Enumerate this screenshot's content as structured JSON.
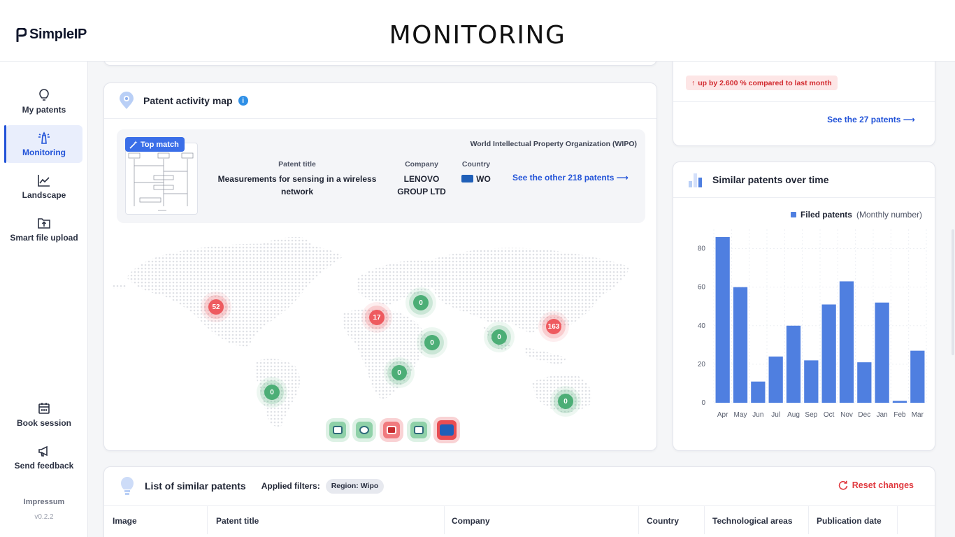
{
  "brand": {
    "name": "SimpleIP"
  },
  "page": {
    "title": "MONITORING"
  },
  "sidebar": {
    "items": [
      {
        "label": "My patents",
        "icon": "lightbulb-icon"
      },
      {
        "label": "Monitoring",
        "icon": "lighthouse-icon",
        "active": true
      },
      {
        "label": "Landscape",
        "icon": "line-chart-icon"
      },
      {
        "label": "Smart file upload",
        "icon": "upload-folder-icon"
      }
    ],
    "bottom_items": [
      {
        "label": "Book session",
        "icon": "calendar-icon"
      },
      {
        "label": "Send feedback",
        "icon": "megaphone-icon"
      }
    ],
    "impressum": "Impressum",
    "version": "v0.2.2"
  },
  "map_card": {
    "title": "Patent activity map",
    "top_match": {
      "badge": "Top match",
      "office": "World Intellectual Property Organization (WIPO)",
      "title_header": "Patent title",
      "title_value": "Measurements for sensing in a wireless network",
      "company_header": "Company",
      "company_value": "LENOVO GROUP LTD",
      "country_header": "Country",
      "country_value": "WO",
      "see_other": "See the other 218 patents"
    },
    "bubbles": [
      {
        "value": "52",
        "status": "red"
      },
      {
        "value": "17",
        "status": "red"
      },
      {
        "value": "0",
        "status": "green"
      },
      {
        "value": "0",
        "status": "green"
      },
      {
        "value": "0",
        "status": "green"
      },
      {
        "value": "163",
        "status": "red"
      },
      {
        "value": "0",
        "status": "green"
      },
      {
        "value": "0",
        "status": "green"
      },
      {
        "value": "0",
        "status": "green"
      }
    ]
  },
  "stats_card": {
    "change": "up by 2.600 % compared to last month",
    "see_patents": "See the 27 patents"
  },
  "chart_card": {
    "title": "Similar patents over time",
    "legend_bold": "Filed patents",
    "legend_note": "(Monthly number)"
  },
  "chart_data": {
    "type": "bar",
    "categories": [
      "Apr",
      "May",
      "Jun",
      "Jul",
      "Aug",
      "Sep",
      "Oct",
      "Nov",
      "Dec",
      "Jan",
      "Feb",
      "Mar"
    ],
    "series": [
      {
        "name": "Filed patents",
        "values": [
          86,
          60,
          11,
          24,
          40,
          22,
          51,
          63,
          21,
          52,
          1,
          27
        ]
      }
    ],
    "yticks": [
      0,
      20,
      40,
      60,
      80
    ],
    "ylim": [
      0,
      90
    ],
    "grid": true,
    "color": "#4f7fe0"
  },
  "list_card": {
    "title": "List of similar patents",
    "filters_label": "Applied filters:",
    "filter_chip": "Region: Wipo",
    "reset": "Reset changes",
    "columns": [
      "Image",
      "Patent title",
      "Company",
      "Country",
      "Technological areas",
      "Publication date"
    ]
  }
}
